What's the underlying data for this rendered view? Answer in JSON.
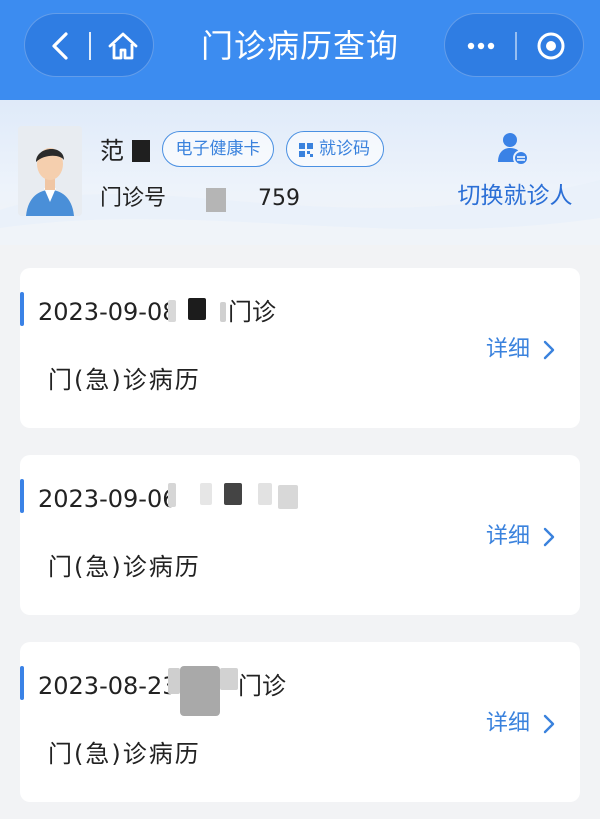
{
  "header": {
    "title": "门诊病历查询",
    "icons": {
      "back": "back-icon",
      "home": "home-icon",
      "more": "more-dots-icon",
      "close": "target-circle-icon"
    },
    "color": "#3c8cf0"
  },
  "patient": {
    "name": "范",
    "health_card_label": "电子健康卡",
    "visit_code_label": "就诊码",
    "outpatient_no_label": "门诊号",
    "outpatient_no_suffix": "759",
    "switch_label": "切换就诊人"
  },
  "records": [
    {
      "date": "2023-09-08",
      "type": "门诊",
      "title": "门(急)诊病历",
      "detail_label": "详细"
    },
    {
      "date": "2023-09-06",
      "type": "",
      "title": "门(急)诊病历",
      "detail_label": "详细"
    },
    {
      "date": "2023-08-23",
      "type": "门诊",
      "title": "门(急)诊病历",
      "detail_label": "详细"
    }
  ],
  "colors": {
    "accent": "#3a82dd",
    "background": "#f2f3f5"
  }
}
